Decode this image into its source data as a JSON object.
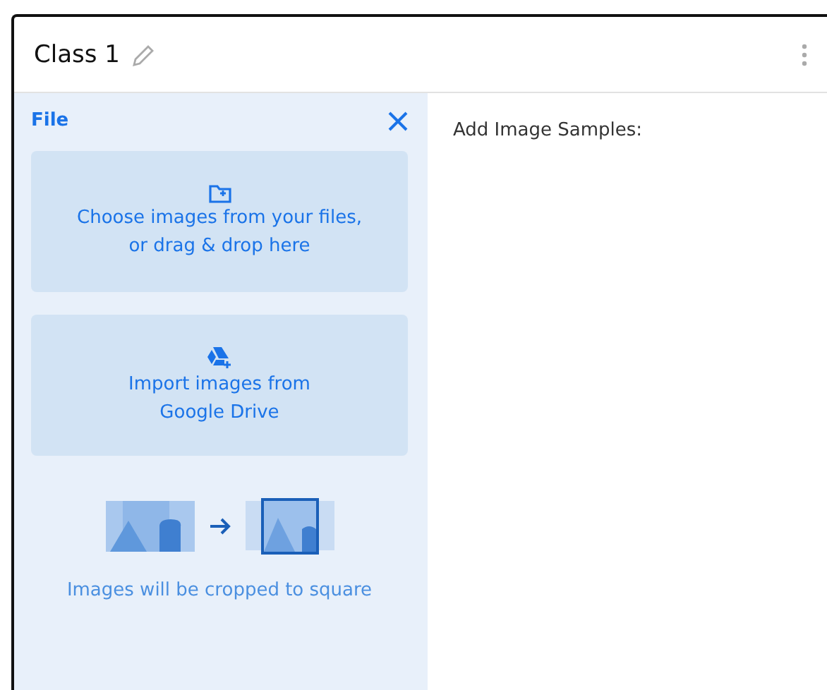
{
  "header": {
    "title": "Class 1"
  },
  "upload_panel": {
    "title": "File",
    "options": [
      {
        "kind": "files",
        "lines": [
          "Choose images from your files,",
          "or drag & drop here"
        ]
      },
      {
        "kind": "drive",
        "lines": [
          "Import images from",
          "Google Drive"
        ]
      }
    ],
    "note": "Images will be cropped to square"
  },
  "samples": {
    "title": "Add Image Samples:"
  }
}
